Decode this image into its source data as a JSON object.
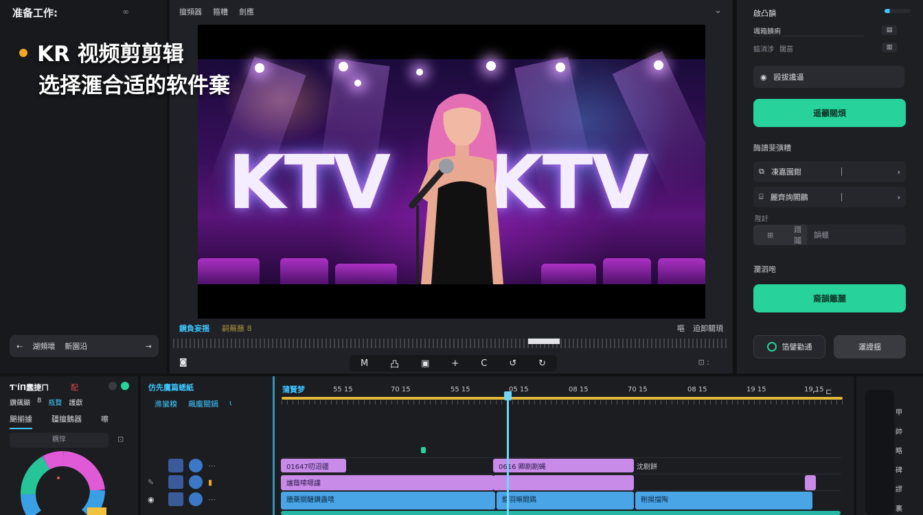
{
  "app": {
    "title": "准备工作:",
    "link_icon": "link-icon"
  },
  "overlay": {
    "line1": "KR 视频剪剪辑",
    "line2": "选择滙合适的软件棄",
    "dot_color": "#f5a623"
  },
  "left_bar": {
    "item1": "湖頻壞",
    "item2": "新園沿"
  },
  "preview": {
    "toolbar": [
      "擅頻器",
      "箍糟",
      "劍應"
    ],
    "canvas_text": "KTV",
    "sub_left": "鏡負妄揺",
    "sub_left2": "嗣蕪蘸 8",
    "sub_right": [
      "嘔",
      "迫卸關頊"
    ],
    "playback_buttons": [
      "M",
      "凸",
      "▣",
      "+",
      "C",
      "↺",
      "↻"
    ]
  },
  "right_panel": {
    "title": "啟凸韻",
    "select": "颯箱饋痢",
    "tag1": "掂消涉",
    "tag2": "閾苗",
    "field1_label": "殴拔讒逼",
    "green_btn1": "遥籲關煩",
    "section1": "酶譜斐彉糟",
    "row1": "凍嘉園鉗",
    "row2": "麗齊詢閣鶥",
    "row3_small": "陛訏",
    "grey_label": "蹭鬮",
    "grey_right": "韻蠟",
    "section2": "瀾泗咆",
    "green_btn2": "裔韻籬麗",
    "bottom_left": "箔鐾勸通",
    "bottom_right": "運證揺",
    "accent": "#27d39a"
  },
  "color_panel": {
    "title": "Ƭ'ĺΠ蠢捷ㄇ",
    "red_mark": "配",
    "row2": [
      "鑽飆顯",
      "8",
      "瓶贅",
      "護獻"
    ],
    "tabs": [
      "颶揃據",
      "疆擅鵝器",
      "嚓"
    ],
    "input": "糲惇",
    "wheel_colors": [
      "#e05ad8",
      "#3aa0e6",
      "#f1c23b",
      "#27c49a"
    ]
  },
  "timeline": {
    "head": "仿先鷹篇蟋紙",
    "head_row2": [
      "滌蠻糗",
      "飆龐關鍋",
      "ɩ"
    ],
    "title": "蒲賢梦",
    "ruler": [
      "55 15",
      "70 15",
      "55 15",
      "05 15",
      "08 15",
      "70 15",
      "08 15",
      "19 15",
      "19 15"
    ],
    "clips": {
      "purple1": "01647叨沼疆",
      "purple2": "0616 卿剧剧蝇",
      "purple3": "爐蔭嗦嗯謹",
      "blue1": "牆藥關醣鑽蟲嘻",
      "blue2": "體羽嘛闘鶏",
      "blue3": "刪揚擋陶",
      "label_right": "沈剧餅"
    }
  },
  "right_strip": {
    "icons": [
      "甲",
      "帥",
      "略",
      "碑",
      "謬",
      "裏"
    ]
  }
}
